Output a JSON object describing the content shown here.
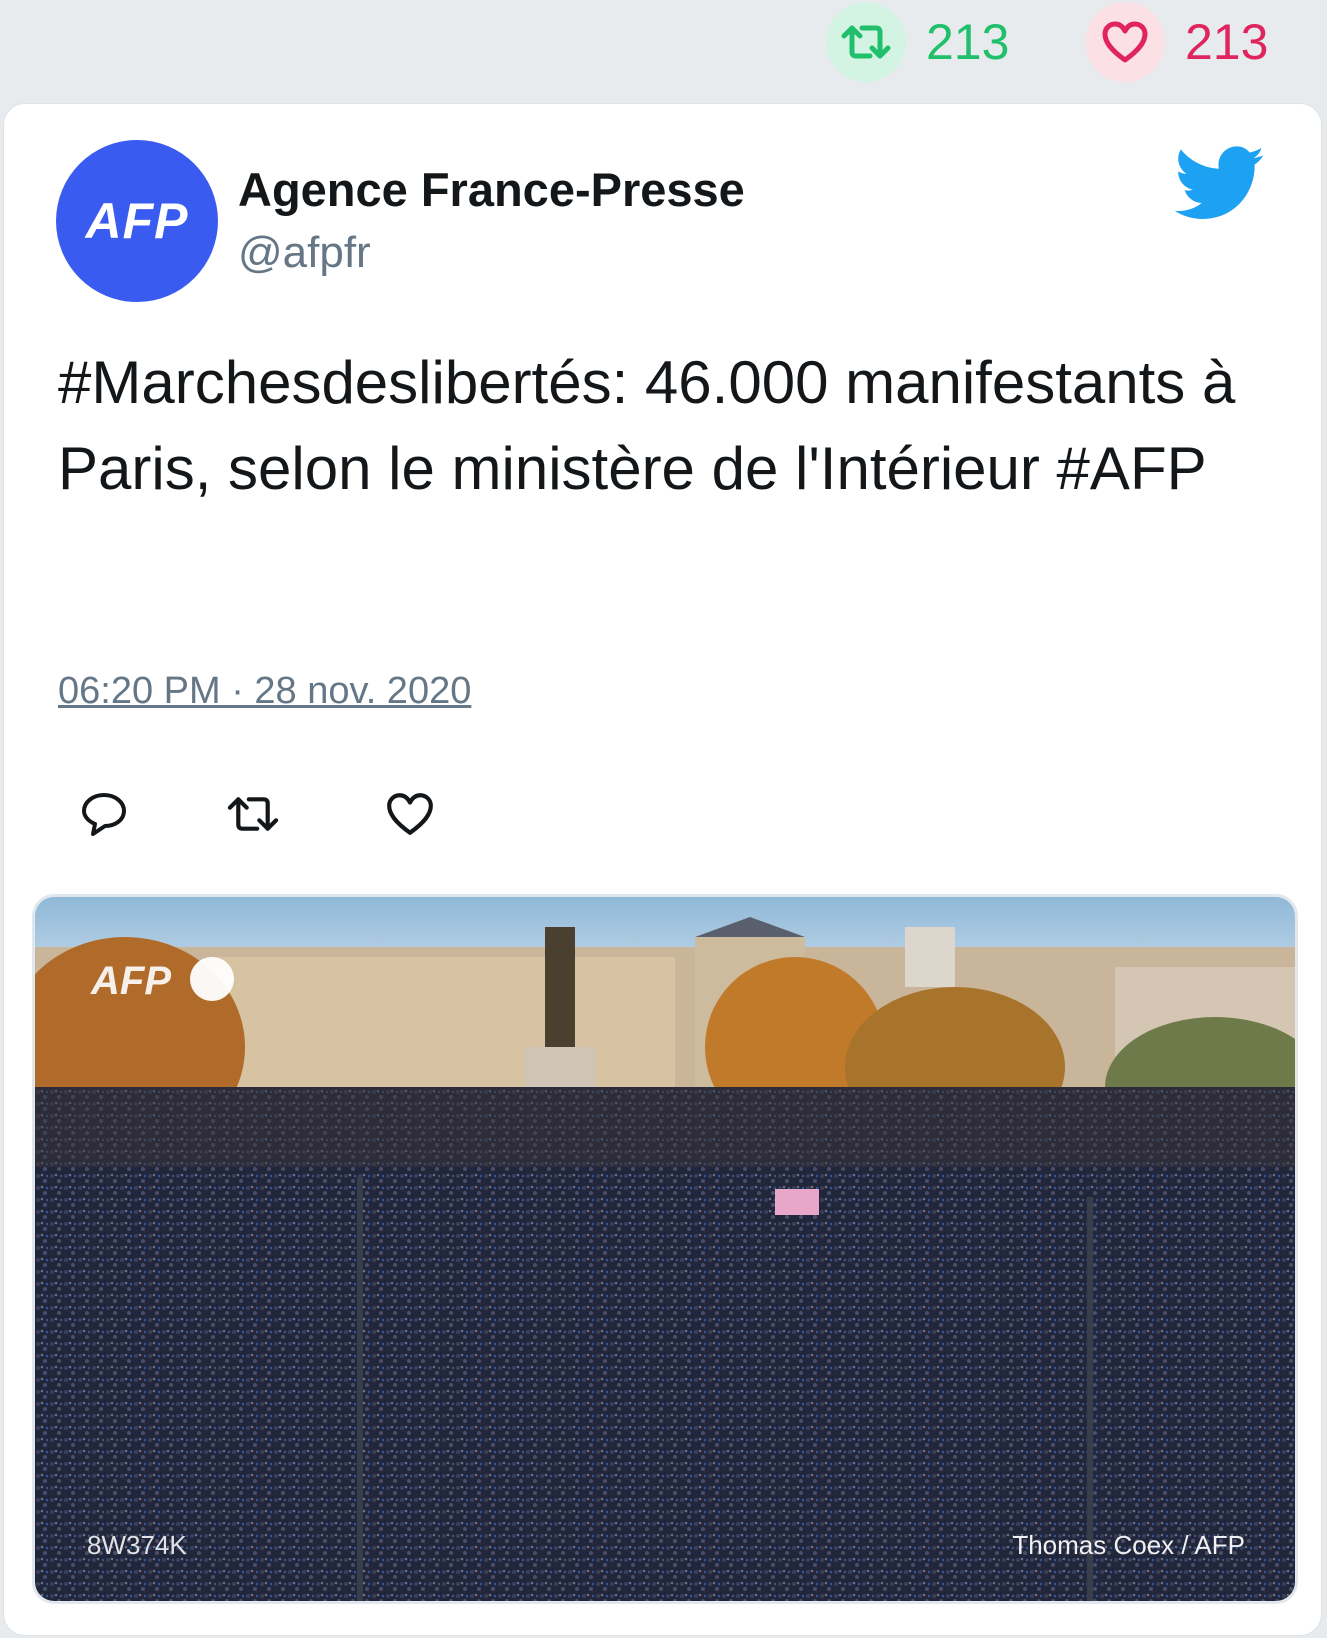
{
  "stats": {
    "retweet_count": "213",
    "like_count": "213",
    "retweet_color": "#20bf6b",
    "like_color": "#e0245e"
  },
  "author": {
    "avatar_text": "AFP",
    "name": "Agence France-Presse",
    "handle": "@afpfr",
    "avatar_color": "#3a5bef"
  },
  "tweet": {
    "text": "#Marchesdeslibertés: 46.000 manifestants à Paris, selon le ministère de l'Intérieur #AFP",
    "timestamp": "06:20 PM · 28 nov. 2020"
  },
  "actions": {
    "reply_icon": "reply-icon",
    "retweet_icon": "retweet-icon",
    "like_icon": "heart-icon"
  },
  "media": {
    "description_icon": "photo",
    "logo_text": "AFP",
    "ref_code": "8W374K",
    "credit": "Thomas Coex / AFP"
  },
  "brand": {
    "twitter_color": "#1da1f2"
  }
}
